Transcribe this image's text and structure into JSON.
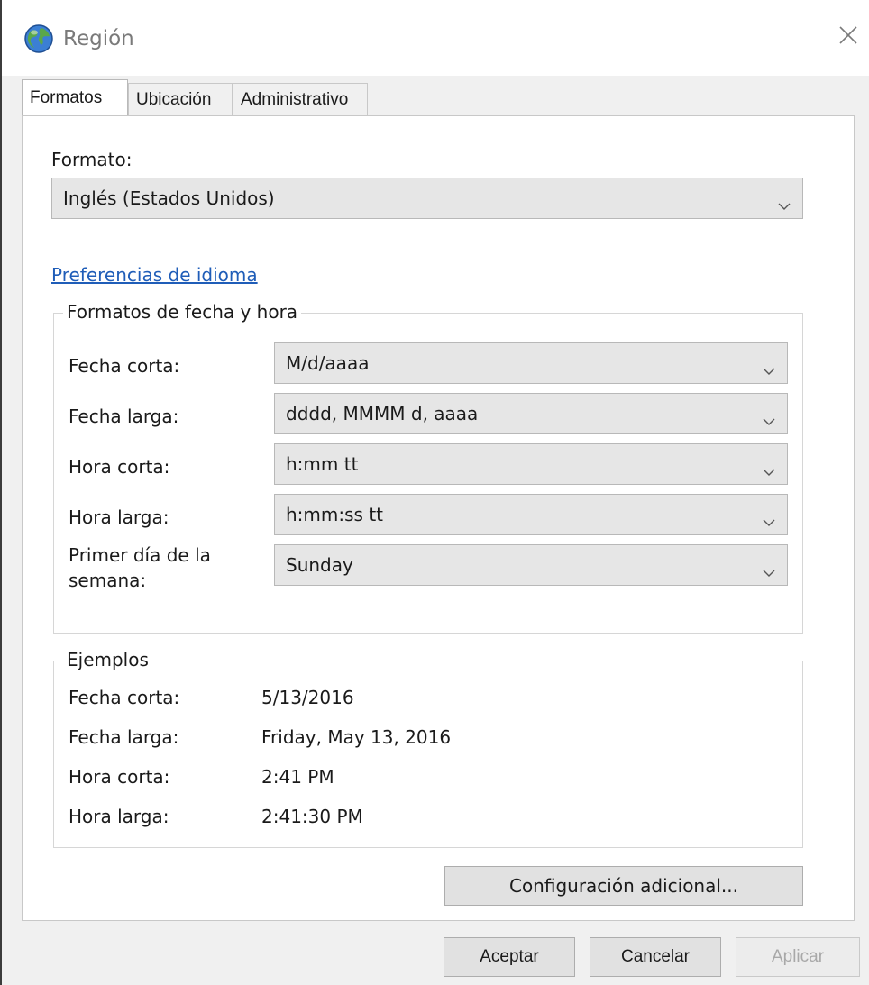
{
  "window": {
    "title": "Región"
  },
  "tabs": [
    {
      "label": "Formatos",
      "active": true
    },
    {
      "label": "Ubicación",
      "active": false
    },
    {
      "label": "Administrativo",
      "active": false
    }
  ],
  "format": {
    "label": "Formato:",
    "value": "Inglés (Estados Unidos)"
  },
  "language_link": "Preferencias de idioma",
  "date_time_formats": {
    "title": "Formatos de fecha y hora",
    "rows": [
      {
        "label": "Fecha corta:",
        "value": "M/d/aaaa"
      },
      {
        "label": "Fecha larga:",
        "value": "dddd, MMMM d, aaaa"
      },
      {
        "label": "Hora corta:",
        "value": "h:mm tt"
      },
      {
        "label": "Hora larga:",
        "value": "h:mm:ss tt"
      },
      {
        "label_line1": "Primer día de la",
        "label_line2": "semana:",
        "value": "Sunday"
      }
    ]
  },
  "examples": {
    "title": "Ejemplos",
    "rows": [
      {
        "label": "Fecha corta:",
        "value": "5/13/2016"
      },
      {
        "label": "Fecha larga:",
        "value": "Friday, May 13, 2016"
      },
      {
        "label": "Hora corta:",
        "value": "2:41 PM"
      },
      {
        "label": "Hora larga:",
        "value": "2:41:30 PM"
      }
    ]
  },
  "buttons": {
    "additional_settings": "Configuración adicional...",
    "ok": "Aceptar",
    "cancel": "Cancelar",
    "apply": "Aplicar"
  },
  "icons": {
    "app": "globe-icon",
    "close": "close-icon",
    "dropdown": "chevron-down-icon"
  }
}
